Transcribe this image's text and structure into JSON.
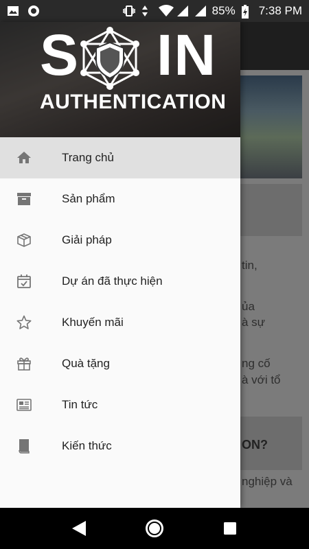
{
  "status_bar": {
    "battery": "85%",
    "time": "7:38 PM",
    "icons": [
      "image-icon",
      "record-icon",
      "vibrate-icon",
      "data-arrows-icon",
      "wifi-icon",
      "signal-icon",
      "signal-icon",
      "battery-charging-icon"
    ]
  },
  "drawer": {
    "logo": {
      "word_left": "S",
      "word_right": "IN",
      "subtitle": "AUTHENTICATION"
    },
    "items": [
      {
        "label": "Trang chủ",
        "icon": "home-icon",
        "active": true
      },
      {
        "label": "Sản phẩm",
        "icon": "archive-box-icon",
        "active": false
      },
      {
        "label": "Giải pháp",
        "icon": "package-icon",
        "active": false
      },
      {
        "label": "Dự án đã thực hiện",
        "icon": "calendar-check-icon",
        "active": false
      },
      {
        "label": "Khuyến mãi",
        "icon": "star-icon",
        "active": false
      },
      {
        "label": "Quà tặng",
        "icon": "gift-icon",
        "active": false
      },
      {
        "label": "Tin tức",
        "icon": "newspaper-icon",
        "active": false
      },
      {
        "label": "Kiến thức",
        "icon": "book-icon",
        "active": false
      }
    ]
  },
  "background": {
    "text_lines": [
      "tin,",
      "ủa",
      "à sự",
      "ng cố",
      "à với tổ"
    ],
    "card_heading": "ON?",
    "last_line": "nghiệp và"
  },
  "nav_bar": {
    "buttons": [
      "back-icon",
      "home-circle-icon",
      "recents-icon"
    ]
  },
  "colors": {
    "drawer_bg": "#fafafa",
    "active_item_bg": "#e0e0e0",
    "icon_gray": "#757575"
  }
}
